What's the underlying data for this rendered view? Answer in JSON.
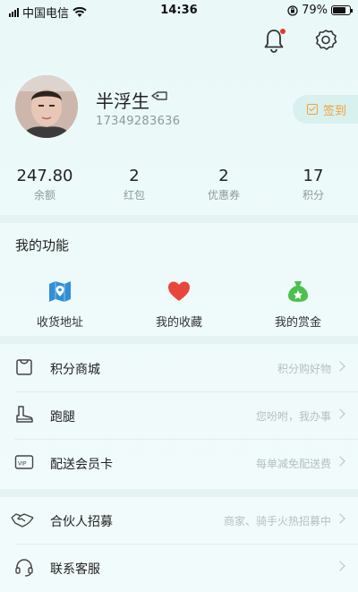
{
  "status_bar": {
    "carrier": "中国电信",
    "time": "14:36",
    "battery": "79%",
    "battery_level": 0.79
  },
  "header": {
    "icons": [
      "bell-icon",
      "gear-icon"
    ],
    "notification_dot_color": "#e53a2e"
  },
  "profile": {
    "name": "半浮生",
    "phone": "17349283636",
    "signin_label": "签到"
  },
  "stats": [
    {
      "value": "247.80",
      "label": "余额"
    },
    {
      "value": "2",
      "label": "红包"
    },
    {
      "value": "2",
      "label": "优惠券"
    },
    {
      "value": "17",
      "label": "积分"
    }
  ],
  "functions": {
    "title": "我的功能",
    "items": [
      {
        "label": "收货地址",
        "icon": "map-pin-icon",
        "color": "#2f8fd8"
      },
      {
        "label": "我的收藏",
        "icon": "heart-icon",
        "color": "#e8463c"
      },
      {
        "label": "我的赏金",
        "icon": "money-bag-icon",
        "color": "#4cc04c"
      }
    ]
  },
  "menu": [
    {
      "label": "积分商城",
      "hint": "积分购好物",
      "icon": "shopping-bag-icon"
    },
    {
      "label": "跑腿",
      "hint": "您吩咐，我办事",
      "icon": "boot-icon"
    },
    {
      "label": "配送会员卡",
      "hint": "每单减免配送费",
      "icon": "vip-card-icon"
    },
    {
      "label": "合伙人招募",
      "hint": "商家、骑手火热招募中",
      "icon": "handshake-icon"
    },
    {
      "label": "联系客服",
      "hint": "",
      "icon": "headset-icon"
    }
  ],
  "colors": {
    "accent_orange": "#f0a23a",
    "background": "#eaf8f8"
  }
}
